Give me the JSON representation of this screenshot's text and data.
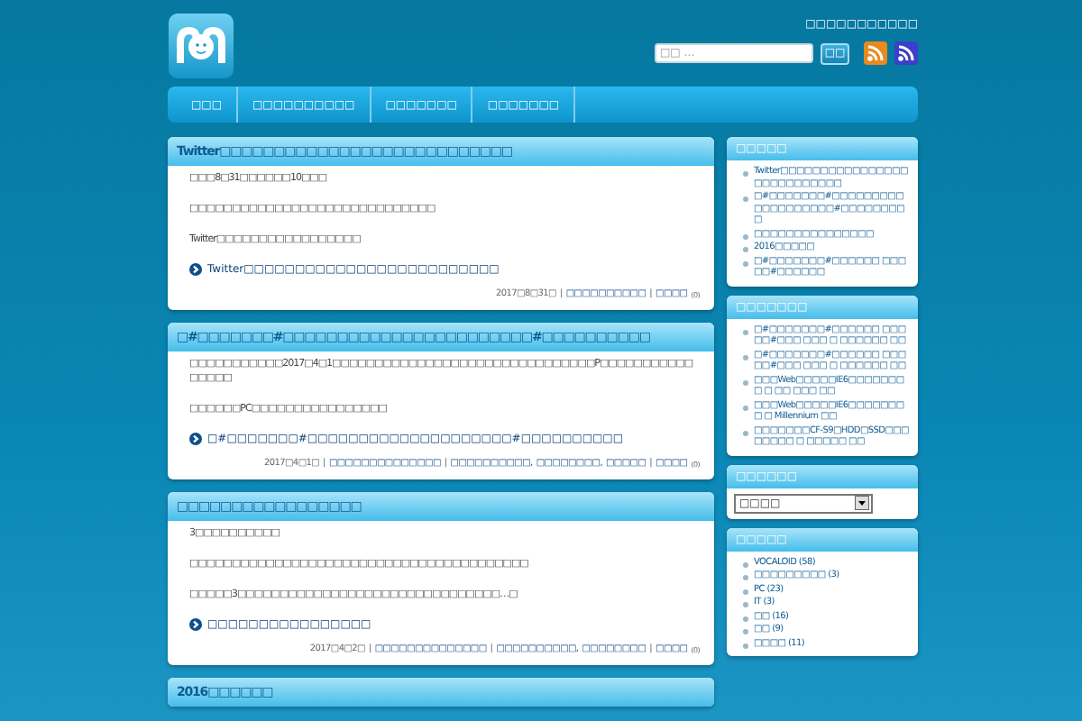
{
  "header": {
    "tagline": "□□□□□□□□□□□",
    "search": {
      "placeholder": "□□ …",
      "button": "□□"
    }
  },
  "nav": {
    "items": [
      {
        "label": "□□□"
      },
      {
        "label": "□□□□□□□□□□"
      },
      {
        "label": "□□□□□□□"
      },
      {
        "label": "□□□□□□□"
      }
    ]
  },
  "posts": [
    {
      "title": "Twitter□□□□□□□□□□□□□□□□□□□□□□□□□□□",
      "paragraphs": [
        "□□□8□31□□□□□□10□□□",
        "□□□□□□□□□□□□□□□□□□□□□□□□□□□□□",
        "Twitter□□□□□□□□□□□□□□□□□"
      ],
      "link": "Twitter□□□□□□□□□□□□□□□□□□□□□□□□□",
      "meta": [
        {
          "kind": "text",
          "text": "2017□8□31□"
        },
        {
          "kind": "sep",
          "text": "|"
        },
        {
          "kind": "category",
          "text": "□□□□□□□□□□"
        },
        {
          "kind": "sep",
          "text": "|"
        },
        {
          "kind": "comments",
          "text": "□□□□"
        },
        {
          "kind": "count",
          "text": "(0)"
        }
      ]
    },
    {
      "title": "□#□□□□□□□#□□□□□□□□□□□□□□□□□□□□□□□#□□□□□□□□□□",
      "paragraphs": [
        "□□□□□□□□□□□2017□4□1□□□□□□□□□□□□□□□□□□□□□□□□□□□□□□□P□□□□□□□□□□□□□□□□",
        "□□□□□□PC□□□□□□□□□□□□□□□□"
      ],
      "link": "□#□□□□□□□#□□□□□□□□□□□□□□□□□□□□#□□□□□□□□□□",
      "meta": [
        {
          "kind": "text",
          "text": "2017□4□1□"
        },
        {
          "kind": "sep",
          "text": "|"
        },
        {
          "kind": "author",
          "text": "□□□□□□□□□□□□□□"
        },
        {
          "kind": "sep",
          "text": "|"
        },
        {
          "kind": "category",
          "text": "□□□□□□□□□□,"
        },
        {
          "kind": "category",
          "text": "□□□□□□□□,"
        },
        {
          "kind": "category",
          "text": "□□□□□"
        },
        {
          "kind": "sep",
          "text": "|"
        },
        {
          "kind": "comments",
          "text": "□□□□"
        },
        {
          "kind": "count",
          "text": "(0)"
        }
      ]
    },
    {
      "title": "□□□□□□□□□□□□□□□□□",
      "paragraphs": [
        "3□□□□□□□□□□",
        "□□□□□□□□□□□□□□□□□□□□□□□□□□□□□□□□□□□□□□□□",
        "□□□□□3□□□□□□□□□□□□□□□□□□□□□□□□□□□□□□□…□"
      ],
      "link": "□□□□□□□□□□□□□□□□",
      "meta": [
        {
          "kind": "text",
          "text": "2017□4□2□"
        },
        {
          "kind": "sep",
          "text": "|"
        },
        {
          "kind": "author",
          "text": "□□□□□□□□□□□□□□"
        },
        {
          "kind": "sep",
          "text": "|"
        },
        {
          "kind": "category",
          "text": "□□□□□□□□□□,"
        },
        {
          "kind": "category",
          "text": "□□□□□□□□"
        },
        {
          "kind": "sep",
          "text": "|"
        },
        {
          "kind": "comments",
          "text": "□□□□"
        },
        {
          "kind": "count",
          "text": "(0)"
        }
      ]
    },
    {
      "title": "2016□□□□□□"
    }
  ],
  "sidebar": [
    {
      "kind": "list",
      "title": "□□□□□",
      "items": [
        "Twitter□□□□□□□□□□□□□□□□□□□□□□□□□□□",
        "□#□□□□□□□#□□□□□□□□□□□□□□□□□□□#□□□□□□□□□",
        "□□□□□□□□□□□□□□□",
        "2016□□□□□",
        "□#□□□□□□□#□□□□□□ □□□□□#□□□□□□"
      ]
    },
    {
      "kind": "list",
      "title": "□□□□□□□",
      "items": [
        "□#□□□□□□□#□□□□□□ □□□□□#□□□ □□□ □ □□□□□□ □□",
        "□#□□□□□□□#□□□□□□ □□□□□#□□□ □□□ □ □□□□□□ □□",
        "□□□Web□□□□□IE6□□□□□□□□ □ □□ □□□ □□",
        "□□□Web□□□□□IE6□□□□□□□□ □ Millennium □□",
        "□□□□□□□CF-S9□HDD□SSD□□□ □□□□□ □ □□□□□ □□"
      ]
    },
    {
      "kind": "select",
      "title": "□□□□□□",
      "value": "□□□□"
    },
    {
      "kind": "list",
      "title": "□□□□□",
      "items": [
        "VOCALOID (58)",
        "□□□□□□□□□ (3)",
        "PC (23)",
        "IT (3)",
        "□□ (16)",
        "□□ (9)",
        "□□□□ (11)"
      ]
    }
  ]
}
